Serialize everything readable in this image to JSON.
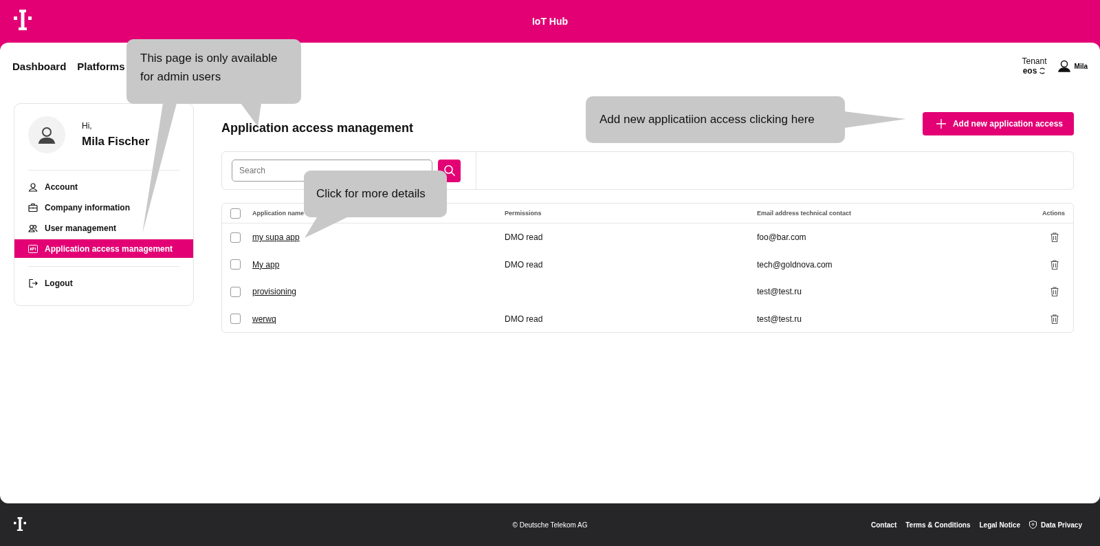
{
  "header": {
    "title": "IoT Hub"
  },
  "nav": [
    {
      "label": "Dashboard"
    },
    {
      "label": "Platforms"
    }
  ],
  "tenant": {
    "label": "Tenant",
    "value": "eos"
  },
  "user": {
    "name": "Mila"
  },
  "profile": {
    "greeting": "Hi,",
    "name": "Mila Fischer"
  },
  "sidebar": {
    "items": [
      {
        "label": "Account",
        "kind": "user",
        "selected": false
      },
      {
        "label": "Company information",
        "kind": "company",
        "selected": false
      },
      {
        "label": "User management",
        "kind": "users",
        "selected": false
      },
      {
        "label": "Application access management",
        "kind": "api",
        "selected": true
      }
    ],
    "footer_items": [
      {
        "label": "Logout",
        "kind": "logout",
        "selected": false
      }
    ]
  },
  "page": {
    "title": "Application access management",
    "add_button": "Add new application access",
    "search": {
      "placeholder": "Search"
    }
  },
  "table": {
    "select_all_checked": false,
    "columns": [
      "Application name",
      "Permissions",
      "Email address technical contact",
      "Actions"
    ],
    "rows": [
      {
        "name": "my supa app",
        "permissions": "DMO read",
        "email": "foo@bar.com",
        "checked": false
      },
      {
        "name": "My app",
        "permissions": "DMO read",
        "email": "tech@goldnova.com",
        "checked": false
      },
      {
        "name": "provisioning",
        "email": "test@test.ru",
        "checked": false
      },
      {
        "name": "werwq",
        "permissions": "DMO read",
        "email": "test@test.ru",
        "checked": false
      }
    ]
  },
  "callouts": [
    {
      "text": "This page is only available for admin users"
    },
    {
      "text": "Add new applicatiion access clicking here"
    },
    {
      "text": "Click for more details"
    }
  ],
  "footer": {
    "copyright": "© Deutsche Telekom AG",
    "links": [
      {
        "label": "Contact",
        "kind": "plain"
      },
      {
        "label": "Terms & Conditions",
        "kind": "plain"
      },
      {
        "label": "Legal Notice",
        "kind": "plain"
      },
      {
        "label": "Data Privacy",
        "kind": "shield"
      }
    ]
  }
}
